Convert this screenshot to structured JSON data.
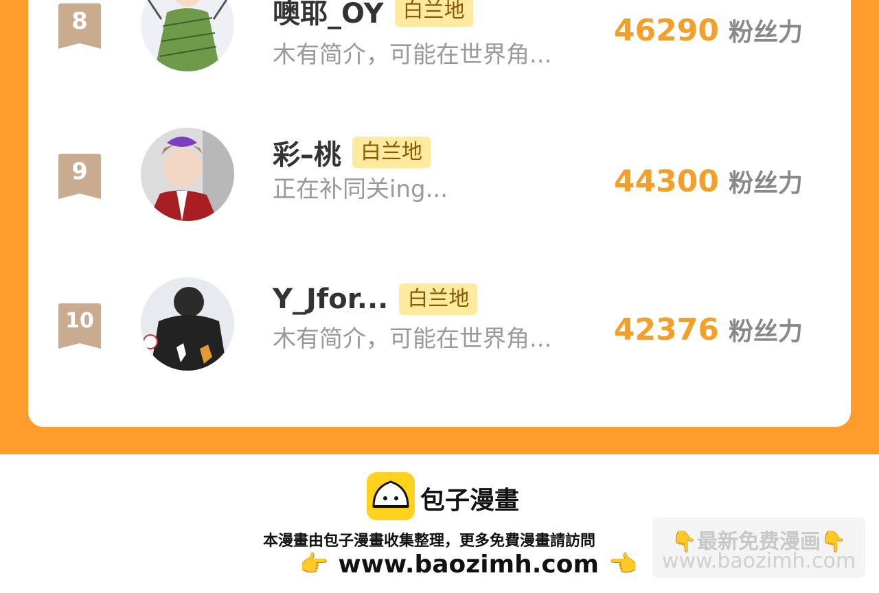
{
  "ranking": {
    "rows": [
      {
        "rank": "8",
        "name": "噢耶_OY",
        "tag": "白兰地",
        "bio": "木有简介，可能在世界角...",
        "fans": "46290",
        "fans_label": "粉丝力"
      },
      {
        "rank": "9",
        "name": "彩–桃",
        "tag": "白兰地",
        "bio": "正在补同关ing...",
        "fans": "44300",
        "fans_label": "粉丝力"
      },
      {
        "rank": "10",
        "name": "Y_Jfor...",
        "tag": "白兰地",
        "bio": "木有简介，可能在世界角...",
        "fans": "42376",
        "fans_label": "粉丝力"
      }
    ]
  },
  "footer": {
    "brand": "包子漫畫",
    "description": "本漫畫由包子漫畫收集整理，更多免費漫畫請訪問",
    "url": "www.baozimh.com",
    "pointer_left": "👉",
    "pointer_right": "👈"
  },
  "watermark": {
    "line1": "👇最新免费漫画👇",
    "line2": "www.baozimh.com"
  },
  "colors": {
    "accent": "#ff9c2b",
    "fans_number": "#f3a02a",
    "tag_bg": "#ffeaa0",
    "badge": "#c9ab90"
  }
}
